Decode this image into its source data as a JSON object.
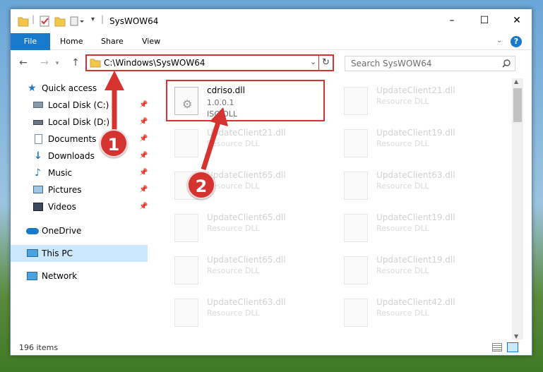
{
  "window": {
    "title": "SysWOW64",
    "controls": [
      "–",
      "☐",
      "✕"
    ]
  },
  "ribbon": {
    "tabs": [
      "File",
      "Home",
      "Share",
      "View"
    ],
    "help": "?"
  },
  "address": {
    "path": "C:\\Windows\\SysWOW64",
    "search_placeholder": "Search SysWOW64"
  },
  "sidebar": {
    "items": [
      {
        "label": "Quick access",
        "icon": "star-icon"
      },
      {
        "label": "Local Disk (C:)",
        "icon": "drive-icon"
      },
      {
        "label": "Local Disk (D:)",
        "icon": "drive-icon"
      },
      {
        "label": "Documents",
        "icon": "documents-icon"
      },
      {
        "label": "Downloads",
        "icon": "download-icon"
      },
      {
        "label": "Music",
        "icon": "music-icon"
      },
      {
        "label": "Pictures",
        "icon": "pictures-icon"
      },
      {
        "label": "Videos",
        "icon": "videos-icon"
      },
      {
        "label": "OneDrive",
        "icon": "cloud-icon"
      },
      {
        "label": "This PC",
        "icon": "pc-icon"
      },
      {
        "label": "Network",
        "icon": "network-icon"
      }
    ]
  },
  "files": [
    {
      "name": "cdriso.dll",
      "line2": "1.0.0.1",
      "line3": "ISO DLL"
    },
    {
      "name": "UpdateClient21.dll",
      "line2": "Resource DLL"
    },
    {
      "name": "UpdateClient21.dll",
      "line2": "Resource DLL"
    },
    {
      "name": "UpdateClient19.dll",
      "line2": "Resource DLL"
    },
    {
      "name": "UpdateClient65.dll",
      "line2": "Resource DLL"
    },
    {
      "name": "UpdateClient63.dll",
      "line2": "Resource DLL"
    },
    {
      "name": "UpdateClient65.dll",
      "line2": "Resource DLL"
    },
    {
      "name": "UpdateClient19.dll",
      "line2": "Resource DLL"
    },
    {
      "name": "UpdateClient65.dll",
      "line2": "Resource DLL"
    },
    {
      "name": "UpdateClient19.dll",
      "line2": "Resource DLL"
    },
    {
      "name": "UpdateClient63.dll",
      "line2": "Resource DLL"
    },
    {
      "name": "UpdateClient42.dll",
      "line2": "Resource DLL"
    }
  ],
  "status": {
    "count": "196 items"
  },
  "annotations": {
    "badge1": "1",
    "badge2": "2"
  },
  "colors": {
    "accent": "#1979ca",
    "highlight": "#d4332f"
  }
}
